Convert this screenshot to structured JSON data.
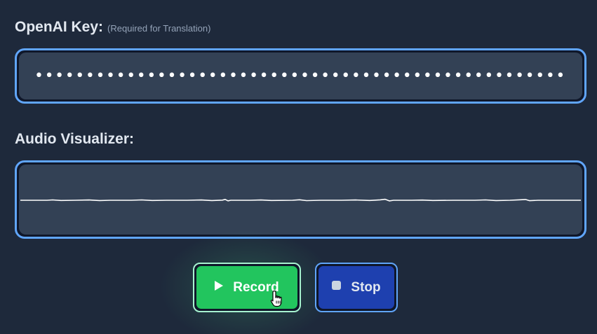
{
  "api_key": {
    "label": "OpenAI Key:",
    "hint": "(Required for Translation)",
    "masked_value": "••••••••••••••••••••••••••••••••••••••••••••••••••••"
  },
  "visualizer": {
    "label": "Audio Visualizer:"
  },
  "controls": {
    "record_label": "Record",
    "stop_label": "Stop"
  },
  "colors": {
    "background": "#1e293b",
    "field_border": "#60a5fa",
    "field_fill": "#334155",
    "record_button": "#22c55e",
    "stop_button": "#1e40af"
  },
  "icons": {
    "record": "play-icon",
    "stop": "stop-icon",
    "cursor": "hand-pointer-icon"
  }
}
